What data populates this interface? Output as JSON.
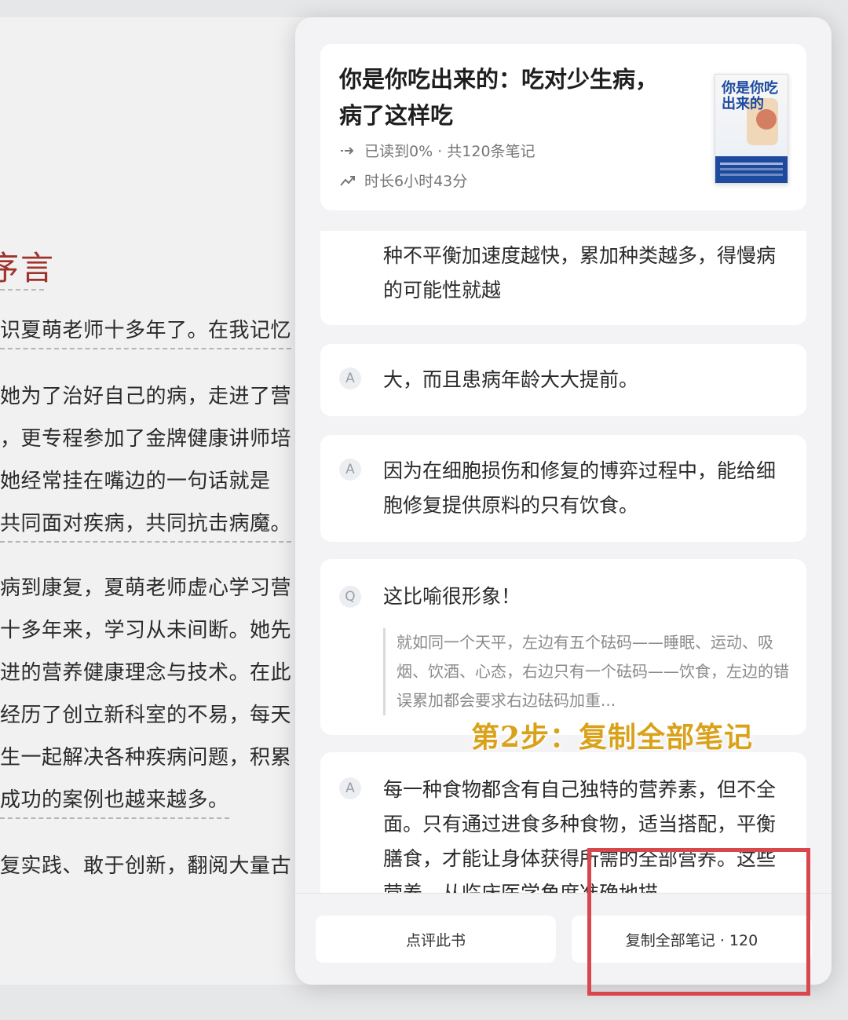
{
  "reader": {
    "chapter_title": "序言",
    "lines": [
      "识夏萌老师十多年了。在我记忆",
      "她为了治好自己的病，走进了营",
      "，更专程参加了金牌健康讲师培",
      "她经常挂在嘴边的一句话就是",
      "共同面对疾病，共同抗击病魔。",
      "病到康复，夏萌老师虚心学习营",
      "十多年来，学习从未间断。她先",
      "进的营养健康理念与技术。在此",
      "经历了创立新科室的不易，每天",
      "生一起解决各种疾病问题，积累",
      "成功的案例也越来越多。",
      "复实践、敢于创新，翻阅大量古"
    ]
  },
  "book": {
    "title_line1": "你是你吃出来的：吃对少生病，",
    "title_line2": "病了这样吃",
    "progress": "已读到0% · 共120条笔记",
    "duration": "时长6小时43分",
    "cover_text": "你是你吃出来的"
  },
  "notes": [
    {
      "text": "种不平衡加速度越快，累加种类越多，得慢病的可能性就越"
    },
    {
      "icon": "A",
      "text": "大，而且患病年龄大大提前。"
    },
    {
      "icon": "A",
      "text": "因为在细胞损伤和修复的博弈过程中，能给细胞修复提供原料的只有饮食。"
    },
    {
      "icon": "Q",
      "text": "这比喻很形象！",
      "quote": "就如同一个天平，左边有五个砝码——睡眠、运动、吸烟、饮酒、心态，右边只有一个砝码——饮食，左边的错误累加都会要求右边砝码加重..."
    },
    {
      "icon": "A",
      "text": "每一种食物都含有自己独特的营养素，但不全面。只有通过进食多种食物，适当搭配，平衡膳食，才能让身体获得所需的全部营养。这些营养，从临床医学角度准确地描"
    }
  ],
  "annotation": {
    "step_label": "第2步：复制全部笔记",
    "highlight_color": "#d9474d",
    "label_color": "#d9a21a"
  },
  "footer": {
    "review_button": "点评此书",
    "copy_button": "复制全部笔记 · 120"
  }
}
